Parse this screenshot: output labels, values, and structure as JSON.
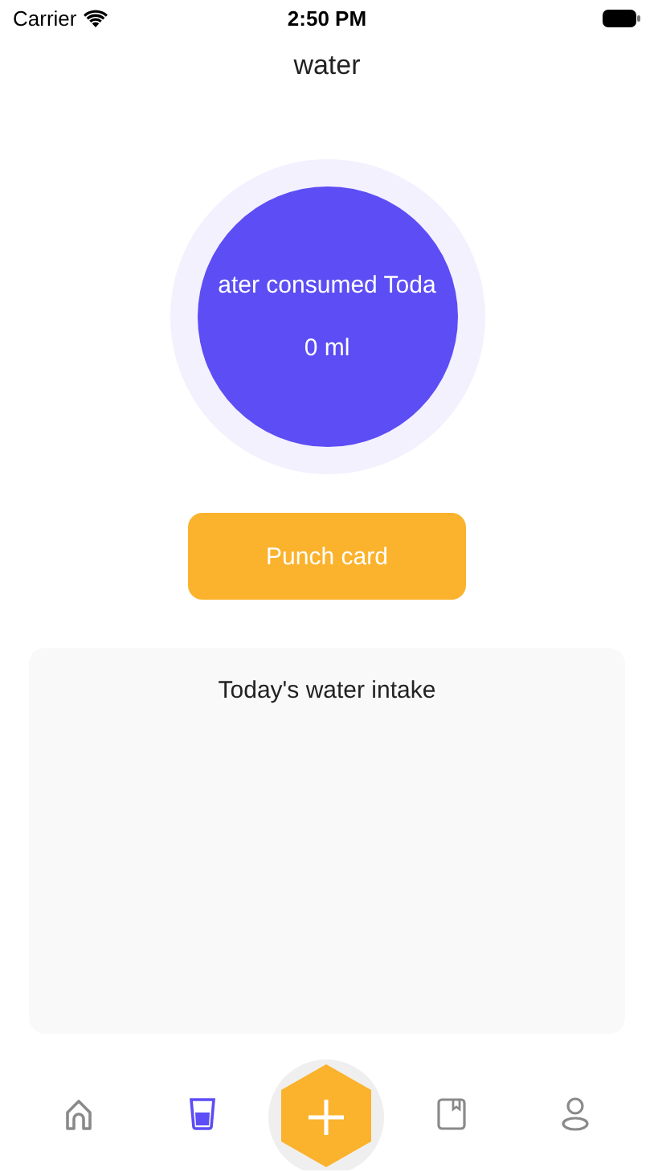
{
  "status_bar": {
    "carrier": "Carrier",
    "time": "2:50 PM"
  },
  "title": "water",
  "gauge": {
    "label": "ater consumed Toda",
    "amount": "0 ml"
  },
  "punch_button": "Punch card",
  "intake_card": {
    "title": "Today's water intake"
  },
  "tab_bar": [
    {
      "kind": "home",
      "selected": false
    },
    {
      "kind": "cup",
      "selected": true
    },
    {
      "kind": "add",
      "selected": false
    },
    {
      "kind": "book",
      "selected": false
    },
    {
      "kind": "user",
      "selected": false
    }
  ]
}
